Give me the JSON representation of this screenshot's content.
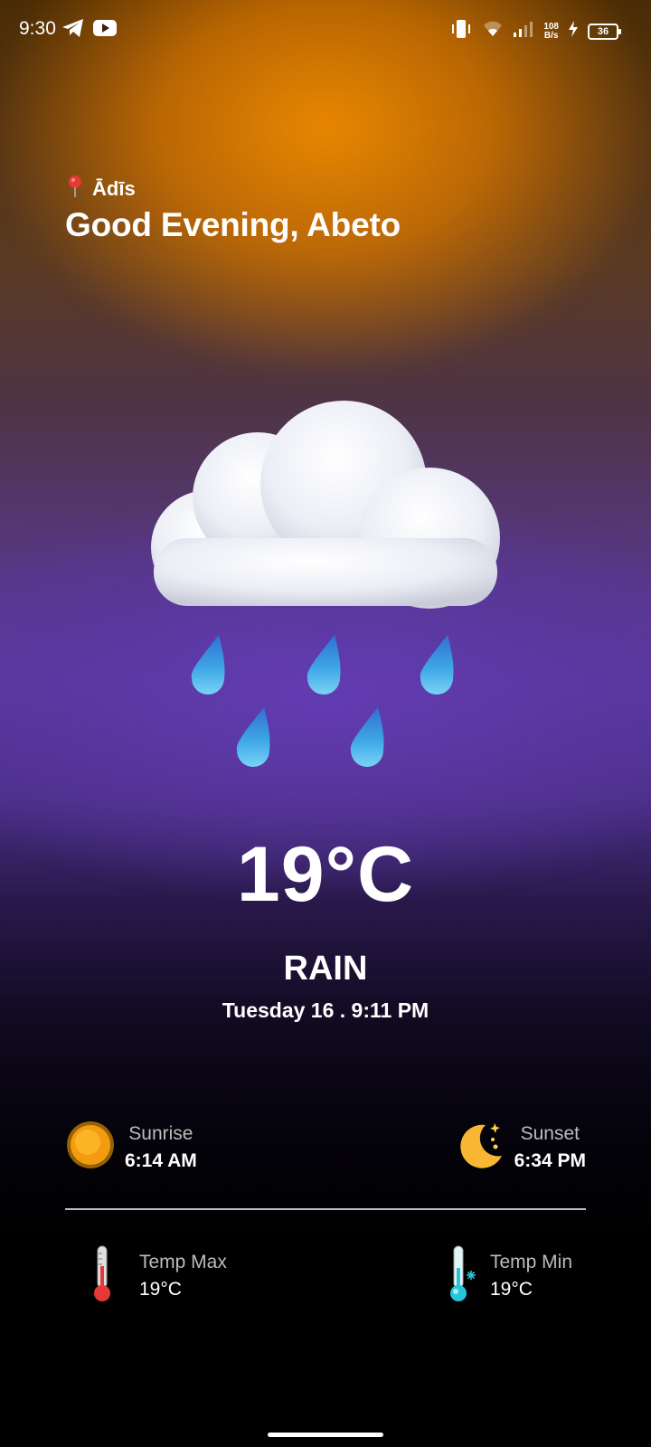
{
  "status_bar": {
    "time": "9:30",
    "net_speed_value": "108",
    "net_speed_unit": "B/s",
    "battery": "36",
    "icons": [
      "telegram-icon",
      "youtube-icon",
      "vibrate-icon",
      "wifi-icon",
      "signal-icon",
      "charging-icon",
      "battery-icon"
    ]
  },
  "header": {
    "location_icon": "pin-icon",
    "location": "Ādīs",
    "greeting": "Good Evening, Abeto"
  },
  "weather": {
    "illustration": "rain-cloud-icon",
    "temperature": "19°C",
    "condition": "RAIN",
    "datetime": "Tuesday 16 . 9:11 PM"
  },
  "details": {
    "sunrise": {
      "icon": "sun-icon",
      "label": "Sunrise",
      "value": "6:14 AM"
    },
    "sunset": {
      "icon": "moon-icon",
      "label": "Sunset",
      "value": "6:34 PM"
    },
    "temp_max": {
      "icon": "thermometer-hot-icon",
      "label": "Temp Max",
      "value": "19°C"
    },
    "temp_min": {
      "icon": "thermometer-cold-icon",
      "label": "Temp Min",
      "value": "19°C"
    }
  },
  "colors": {
    "top_glow": "#e08600",
    "mid_glow": "#5b3aa2",
    "divider": "#bdbdbd",
    "secondary_text": "#bcbcbc"
  }
}
